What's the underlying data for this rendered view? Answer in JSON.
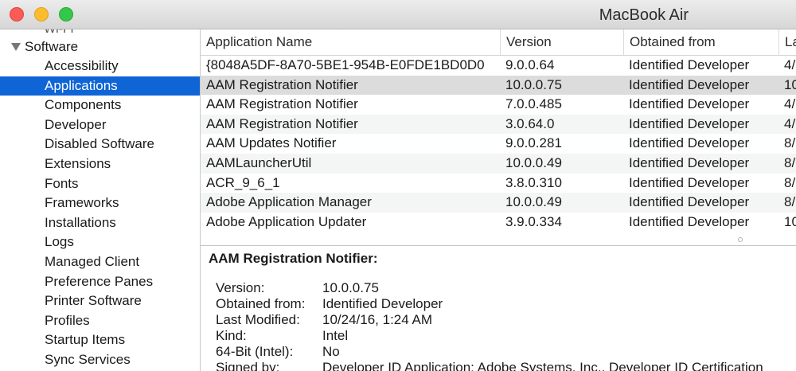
{
  "window": {
    "title": "MacBook Air"
  },
  "sidebar": {
    "partial_item": "Wi-Fi",
    "group_label": "Software",
    "items": [
      {
        "label": "Accessibility"
      },
      {
        "label": "Applications",
        "selected": true
      },
      {
        "label": "Components"
      },
      {
        "label": "Developer"
      },
      {
        "label": "Disabled Software"
      },
      {
        "label": "Extensions"
      },
      {
        "label": "Fonts"
      },
      {
        "label": "Frameworks"
      },
      {
        "label": "Installations"
      },
      {
        "label": "Logs"
      },
      {
        "label": "Managed Client"
      },
      {
        "label": "Preference Panes"
      },
      {
        "label": "Printer Software"
      },
      {
        "label": "Profiles"
      },
      {
        "label": "Startup Items"
      },
      {
        "label": "Sync Services"
      }
    ]
  },
  "table": {
    "columns": [
      "Application Name",
      "Version",
      "Obtained from",
      "La"
    ],
    "rows": [
      {
        "name": "{8048A5DF-8A70-5BE1-954B-E0FDE1BD0D0",
        "version": "9.0.0.64",
        "obtained": "Identified Developer",
        "last": "4/"
      },
      {
        "name": "AAM Registration Notifier",
        "version": "10.0.0.75",
        "obtained": "Identified Developer",
        "last": "10"
      },
      {
        "name": "AAM Registration Notifier",
        "version": "7.0.0.485",
        "obtained": "Identified Developer",
        "last": "4/"
      },
      {
        "name": "AAM Registration Notifier",
        "version": "3.0.64.0",
        "obtained": "Identified Developer",
        "last": "4/"
      },
      {
        "name": "AAM Updates Notifier",
        "version": "9.0.0.281",
        "obtained": "Identified Developer",
        "last": "8/"
      },
      {
        "name": "AAMLauncherUtil",
        "version": "10.0.0.49",
        "obtained": "Identified Developer",
        "last": "8/"
      },
      {
        "name": "ACR_9_6_1",
        "version": "3.8.0.310",
        "obtained": "Identified Developer",
        "last": "8/"
      },
      {
        "name": "Adobe Application Manager",
        "version": "10.0.0.49",
        "obtained": "Identified Developer",
        "last": "8/"
      },
      {
        "name": "Adobe Application Updater",
        "version": "3.9.0.334",
        "obtained": "Identified Developer",
        "last": "10"
      }
    ],
    "highlighted_row": 1
  },
  "detail": {
    "title": "AAM Registration Notifier:",
    "fields": [
      {
        "label": "Version:",
        "value": "10.0.0.75"
      },
      {
        "label": "Obtained from:",
        "value": "Identified Developer"
      },
      {
        "label": "Last Modified:",
        "value": "10/24/16, 1:24 AM"
      },
      {
        "label": "Kind:",
        "value": "Intel"
      },
      {
        "label": "64-Bit (Intel):",
        "value": "No"
      },
      {
        "label": "Signed by:",
        "value": "Developer ID Application: Adobe Systems, Inc., Developer ID Certification"
      }
    ]
  },
  "colors": {
    "selection": "#0f65d6",
    "row_highlight": "#dcdcdc",
    "close": "#fc5b57",
    "minimize": "#fdbc2e",
    "zoom": "#34c84a"
  }
}
